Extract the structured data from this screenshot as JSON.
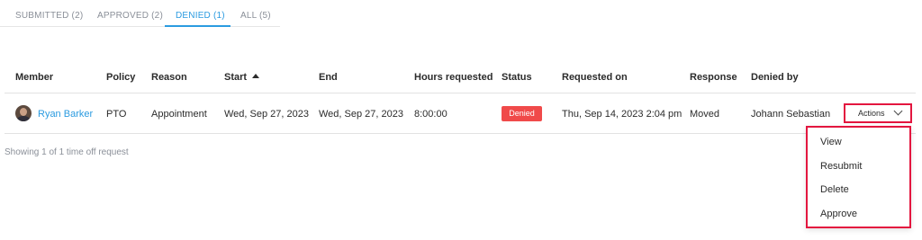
{
  "tabs": [
    {
      "label": "SUBMITTED (2)"
    },
    {
      "label": "APPROVED (2)"
    },
    {
      "label": "DENIED (1)"
    },
    {
      "label": "ALL (5)"
    }
  ],
  "active_tab": "DENIED (1)",
  "table": {
    "headers": {
      "member": "Member",
      "policy": "Policy",
      "reason": "Reason",
      "start": "Start",
      "end": "End",
      "hours": "Hours requested",
      "status": "Status",
      "requested_on": "Requested on",
      "response": "Response",
      "denied_by": "Denied by"
    },
    "sort_icon": "sort-ascending-icon",
    "rows": [
      {
        "member": "Ryan Barker",
        "policy": "PTO",
        "reason": "Appointment",
        "start": "Wed, Sep 27, 2023",
        "end": "Wed, Sep 27, 2023",
        "hours": "8:00:00",
        "status": "Denied",
        "requested_on": "Thu, Sep 14, 2023 2:04 pm",
        "response": "Moved",
        "denied_by": "Johann Sebastian",
        "actions_label": "Actions"
      }
    ]
  },
  "actions_menu": [
    "View",
    "Resubmit",
    "Delete",
    "Approve"
  ],
  "footer": "Showing 1 of 1 time off request",
  "colors": {
    "accent": "#2b9be0",
    "status_denied": "#f04a4a",
    "highlight": "#e3163f"
  }
}
